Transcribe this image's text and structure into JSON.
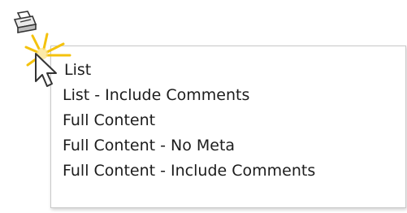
{
  "toolbar": {
    "print_icon": "printer-icon"
  },
  "print_menu": {
    "items": [
      {
        "label": "List"
      },
      {
        "label": "List - Include Comments"
      },
      {
        "label": "Full Content"
      },
      {
        "label": "Full Content - No Meta"
      },
      {
        "label": "Full Content - Include Comments"
      }
    ]
  },
  "overlay": {
    "cursor_icon": "arrow-cursor-icon",
    "highlight": "click-burst-icon",
    "highlight_color": "#f4c20d"
  }
}
